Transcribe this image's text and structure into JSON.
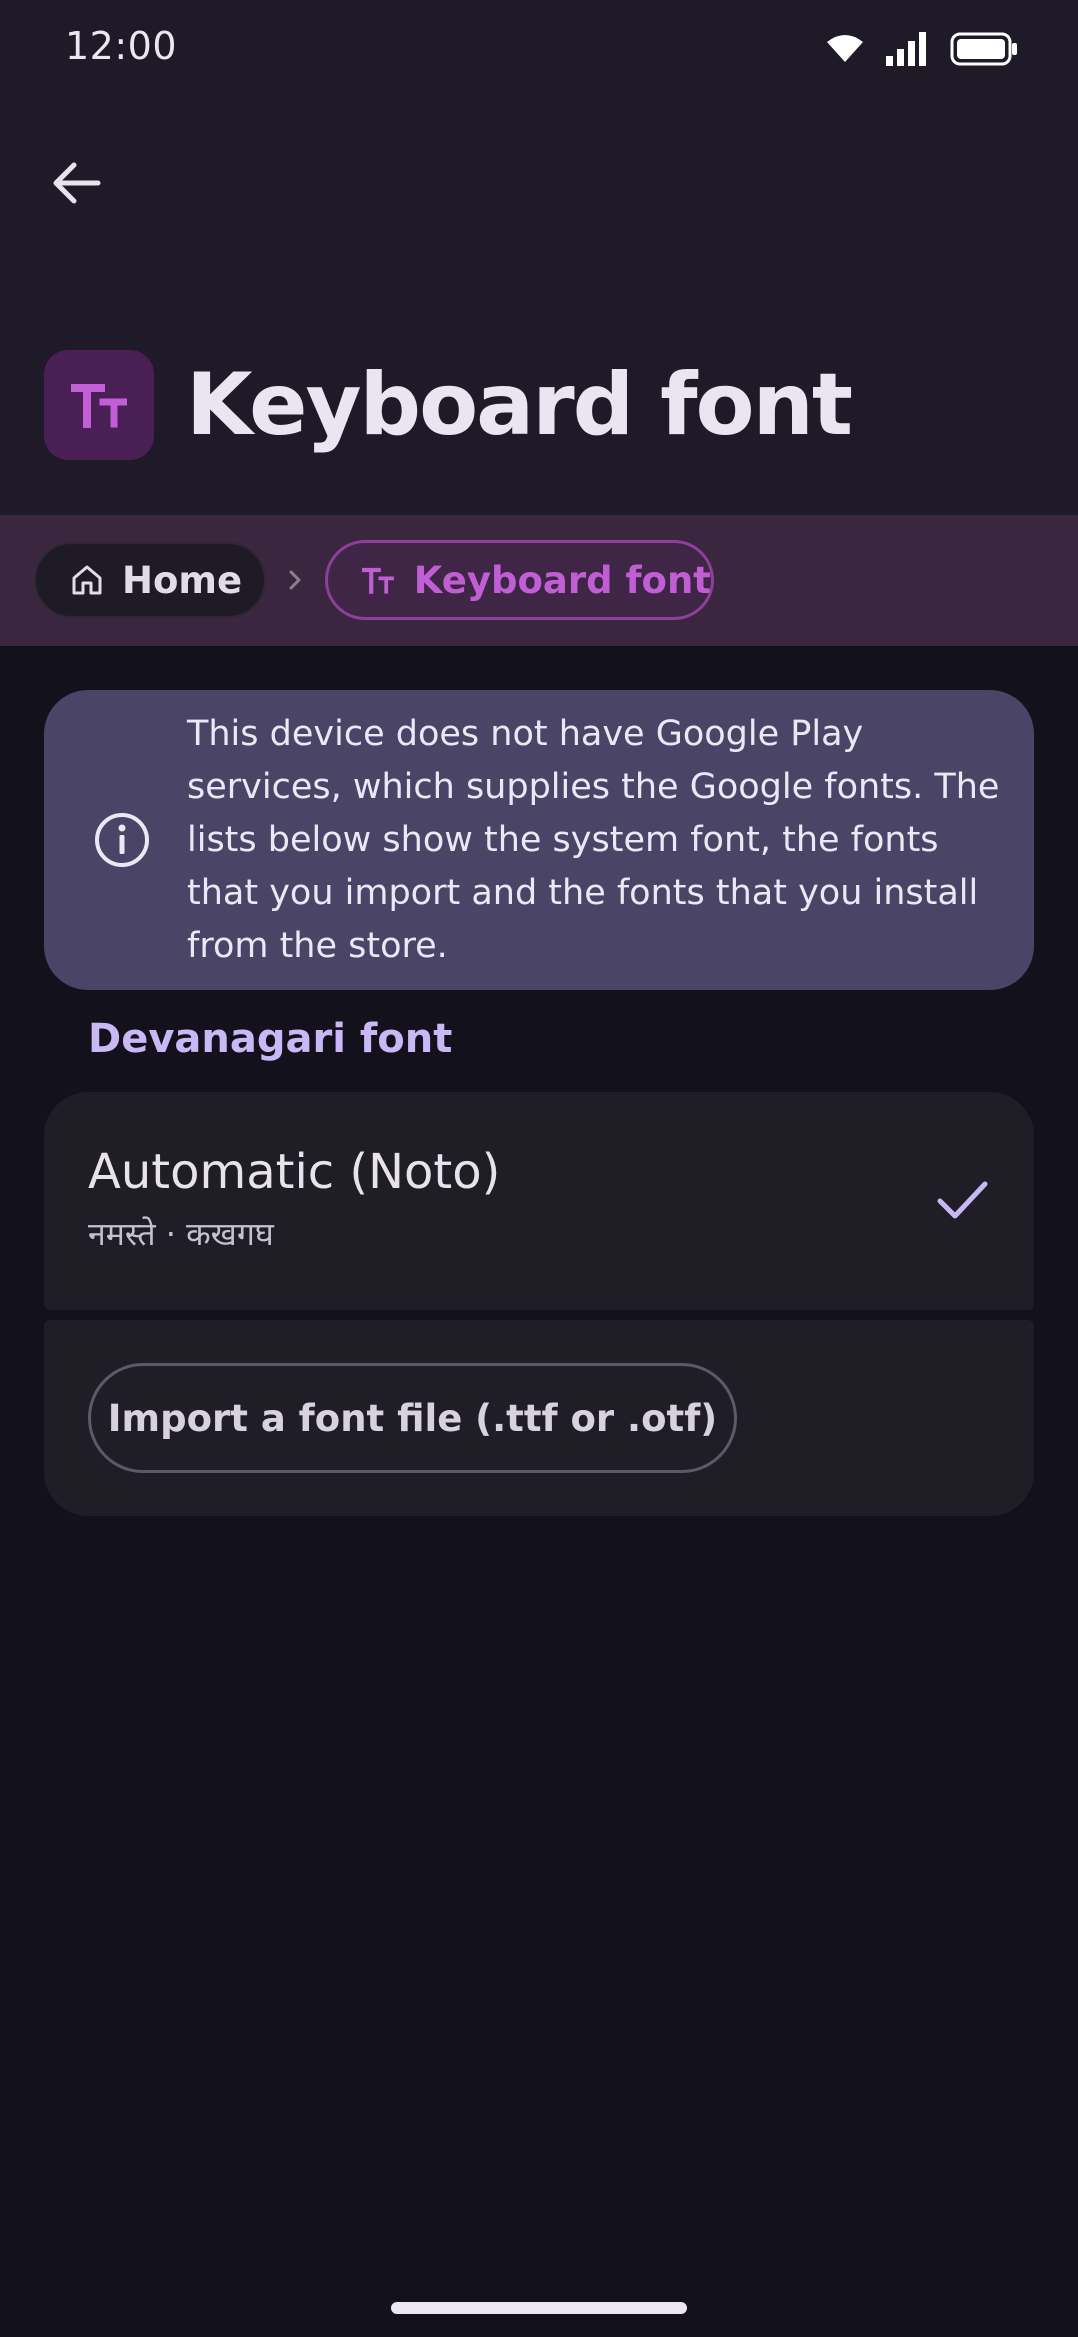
{
  "status_bar": {
    "time": "12:00",
    "icons": [
      "wifi-icon",
      "signal-icon",
      "battery-icon"
    ]
  },
  "header": {
    "back_icon": "arrow-left-icon",
    "title_icon": "text-size-icon",
    "title": "Keyboard font"
  },
  "breadcrumb": {
    "home_label": "Home",
    "current_label": "Keyboard font"
  },
  "info": {
    "icon": "info-icon",
    "text": "This device does not have Google Play services, which supplies the Google fonts. The lists below show the system font, the fonts that you import and the fonts that you install from the store."
  },
  "section": {
    "title": "Devanagari font"
  },
  "font_options": [
    {
      "name": "Automatic (Noto)",
      "sample": "नमस्ते · कखगघ",
      "selected": true
    }
  ],
  "import": {
    "label": "Import a font file (.ttf or .otf)"
  },
  "colors": {
    "background": "#13121c",
    "header_background": "#1e1a27",
    "breadcrumb_background": "#3b2640",
    "accent_purple": "#c15ed4",
    "info_card": "#4a4567",
    "section_title": "#c8b8f6"
  }
}
